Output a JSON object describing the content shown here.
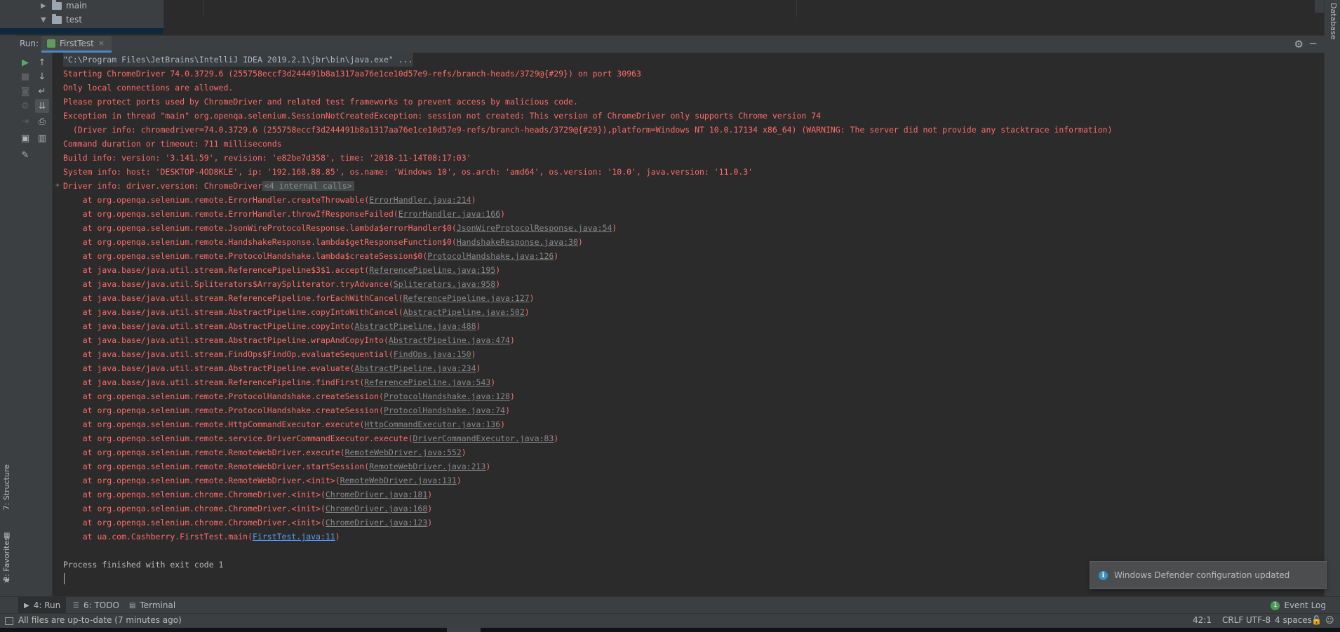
{
  "project_tree": {
    "items": [
      {
        "label": "main",
        "expanded": false
      },
      {
        "label": "test",
        "expanded": true
      }
    ]
  },
  "right_strip": {
    "label": "Database"
  },
  "run_panel": {
    "label": "Run:",
    "tab": {
      "label": "FirstTest",
      "close": "×"
    }
  },
  "side_strip": {
    "structure": "7: Structure",
    "favorites": "2: Favorites"
  },
  "console": {
    "lines": [
      {
        "text": "\"C:\\Program Files\\JetBrains\\IntelliJ IDEA 2019.2.1\\jbr\\bin\\java.exe\" ...",
        "kind": "cmd"
      },
      {
        "text": "Starting ChromeDriver 74.0.3729.6 (255758eccf3d244491b8a1317aa76e1ce10d57e9-refs/branch-heads/3729@{#29}) on port 30963",
        "kind": "err"
      },
      {
        "text": "Only local connections are allowed.",
        "kind": "err"
      },
      {
        "text": "Please protect ports used by ChromeDriver and related test frameworks to prevent access by malicious code.",
        "kind": "err"
      },
      {
        "text": "Exception in thread \"main\" org.openqa.selenium.SessionNotCreatedException: session not created: This version of ChromeDriver only supports Chrome version 74",
        "kind": "err"
      },
      {
        "text": "  (Driver info: chromedriver=74.0.3729.6 (255758eccf3d244491b8a1317aa76e1ce10d57e9-refs/branch-heads/3729@{#29}),platform=Windows NT 10.0.17134 x86_64) (WARNING: The server did not provide any stacktrace information)",
        "kind": "err"
      },
      {
        "text": "Command duration or timeout: 711 milliseconds",
        "kind": "err"
      },
      {
        "text": "Build info: version: '3.141.59', revision: 'e82be7d358', time: '2018-11-14T08:17:03'",
        "kind": "err"
      },
      {
        "text": "System info: host: 'DESKTOP-4OD8KLE', ip: '192.168.88.85', os.name: 'Windows 10', os.arch: 'amd64', os.version: '10.0', java.version: '11.0.3'",
        "kind": "err"
      }
    ],
    "driver_line": {
      "text": "Driver info: driver.version: ChromeDriver",
      "fold": "<4 internal calls>",
      "marker": "+"
    },
    "stack": [
      {
        "prefix": "    at org.openqa.selenium.remote.ErrorHandler.createThrowable(",
        "link": "ErrorHandler.java:214",
        "suffix": ")"
      },
      {
        "prefix": "    at org.openqa.selenium.remote.ErrorHandler.throwIfResponseFailed(",
        "link": "ErrorHandler.java:166",
        "suffix": ")"
      },
      {
        "prefix": "    at org.openqa.selenium.remote.JsonWireProtocolResponse.lambda$errorHandler$0(",
        "link": "JsonWireProtocolResponse.java:54",
        "suffix": ")"
      },
      {
        "prefix": "    at org.openqa.selenium.remote.HandshakeResponse.lambda$getResponseFunction$0(",
        "link": "HandshakeResponse.java:30",
        "suffix": ")"
      },
      {
        "prefix": "    at org.openqa.selenium.remote.ProtocolHandshake.lambda$createSession$0(",
        "link": "ProtocolHandshake.java:126",
        "suffix": ")"
      },
      {
        "prefix": "    at java.base/java.util.stream.ReferencePipeline$3$1.accept(",
        "link": "ReferencePipeline.java:195",
        "suffix": ")"
      },
      {
        "prefix": "    at java.base/java.util.Spliterators$ArraySpliterator.tryAdvance(",
        "link": "Spliterators.java:958",
        "suffix": ")"
      },
      {
        "prefix": "    at java.base/java.util.stream.ReferencePipeline.forEachWithCancel(",
        "link": "ReferencePipeline.java:127",
        "suffix": ")"
      },
      {
        "prefix": "    at java.base/java.util.stream.AbstractPipeline.copyIntoWithCancel(",
        "link": "AbstractPipeline.java:502",
        "suffix": ")"
      },
      {
        "prefix": "    at java.base/java.util.stream.AbstractPipeline.copyInto(",
        "link": "AbstractPipeline.java:488",
        "suffix": ")"
      },
      {
        "prefix": "    at java.base/java.util.stream.AbstractPipeline.wrapAndCopyInto(",
        "link": "AbstractPipeline.java:474",
        "suffix": ")"
      },
      {
        "prefix": "    at java.base/java.util.stream.FindOps$FindOp.evaluateSequential(",
        "link": "FindOps.java:150",
        "suffix": ")"
      },
      {
        "prefix": "    at java.base/java.util.stream.AbstractPipeline.evaluate(",
        "link": "AbstractPipeline.java:234",
        "suffix": ")"
      },
      {
        "prefix": "    at java.base/java.util.stream.ReferencePipeline.findFirst(",
        "link": "ReferencePipeline.java:543",
        "suffix": ")"
      },
      {
        "prefix": "    at org.openqa.selenium.remote.ProtocolHandshake.createSession(",
        "link": "ProtocolHandshake.java:128",
        "suffix": ")"
      },
      {
        "prefix": "    at org.openqa.selenium.remote.ProtocolHandshake.createSession(",
        "link": "ProtocolHandshake.java:74",
        "suffix": ")"
      },
      {
        "prefix": "    at org.openqa.selenium.remote.HttpCommandExecutor.execute(",
        "link": "HttpCommandExecutor.java:136",
        "suffix": ")"
      },
      {
        "prefix": "    at org.openqa.selenium.remote.service.DriverCommandExecutor.execute(",
        "link": "DriverCommandExecutor.java:83",
        "suffix": ")"
      },
      {
        "prefix": "    at org.openqa.selenium.remote.RemoteWebDriver.execute(",
        "link": "RemoteWebDriver.java:552",
        "suffix": ")"
      },
      {
        "prefix": "    at org.openqa.selenium.remote.RemoteWebDriver.startSession(",
        "link": "RemoteWebDriver.java:213",
        "suffix": ")"
      },
      {
        "prefix": "    at org.openqa.selenium.remote.RemoteWebDriver.<init>(",
        "link": "RemoteWebDriver.java:131",
        "suffix": ")"
      },
      {
        "prefix": "    at org.openqa.selenium.chrome.ChromeDriver.<init>(",
        "link": "ChromeDriver.java:181",
        "suffix": ")"
      },
      {
        "prefix": "    at org.openqa.selenium.chrome.ChromeDriver.<init>(",
        "link": "ChromeDriver.java:168",
        "suffix": ")"
      },
      {
        "prefix": "    at org.openqa.selenium.chrome.ChromeDriver.<init>(",
        "link": "ChromeDriver.java:123",
        "suffix": ")"
      },
      {
        "prefix": "    at ua.com.Cashberry.FirstTest.main(",
        "link": "FirstTest.java:11",
        "suffix": ")",
        "user_code": true
      }
    ],
    "exit_line": "Process finished with exit code 1"
  },
  "notification": {
    "icon": "info-icon",
    "text": "Windows Defender configuration updated"
  },
  "bottom_tabs": [
    {
      "label": "4: Run",
      "icon": "run-icon",
      "active": true
    },
    {
      "label": "6: TODO",
      "icon": "todo-icon",
      "active": false
    },
    {
      "label": "Terminal",
      "icon": "terminal-icon",
      "active": false
    }
  ],
  "event_log": {
    "label": "Event Log",
    "badge": "1"
  },
  "status_bar": {
    "message": "All files are up-to-date (7 minutes ago)",
    "position": "42:1",
    "line_separator": "CRLF",
    "encoding": "UTF-8",
    "indent": "4 spaces"
  },
  "colors": {
    "error": "#ff6b68",
    "accent": "#4a88c7",
    "background": "#2b2b2b"
  }
}
